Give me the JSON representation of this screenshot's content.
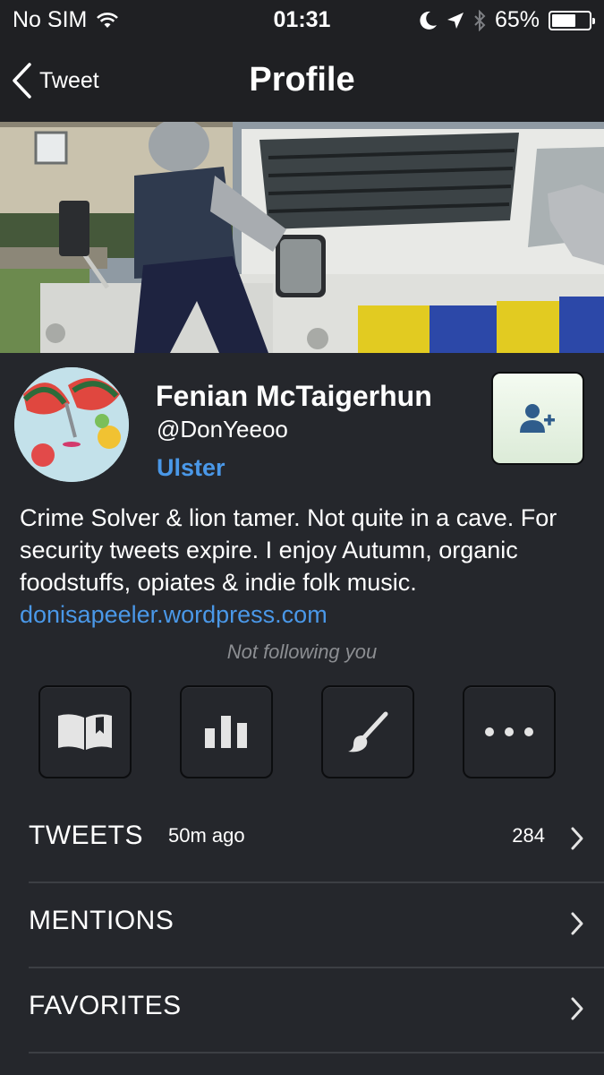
{
  "status_bar": {
    "carrier": "No SIM",
    "time": "01:31",
    "battery_percent": "65%",
    "battery_level": 0.65,
    "icons": [
      "wifi-icon",
      "moon-icon",
      "location-arrow-icon",
      "bluetooth-icon",
      "battery-icon"
    ]
  },
  "nav": {
    "back_label": "Tweet",
    "title": "Profile"
  },
  "profile": {
    "name": "Fenian McTaigerhun",
    "handle": "@DonYeeoo",
    "location": "Ulster",
    "bio_text": "Crime Solver & lion tamer. Not quite in a cave. For security tweets expire. I enjoy Autumn, organic foodstuffs, opiates & indie folk music. ",
    "bio_link": "donisapeeler.wordpress.com",
    "follow_status": "Not following you"
  },
  "actions": [
    {
      "icon": "book-icon"
    },
    {
      "icon": "bar-chart-icon"
    },
    {
      "icon": "paintbrush-icon"
    },
    {
      "icon": "more-icon"
    }
  ],
  "rows": [
    {
      "label": "TWEETS",
      "time": "50m ago",
      "count": "284"
    },
    {
      "label": "MENTIONS",
      "time": "",
      "count": ""
    },
    {
      "label": "FAVORITES",
      "time": "",
      "count": ""
    }
  ],
  "colors": {
    "background": "#25272c",
    "bar": "#1f2023",
    "accent_link": "#4a98e8",
    "follow_button": "#e6f2e2"
  }
}
